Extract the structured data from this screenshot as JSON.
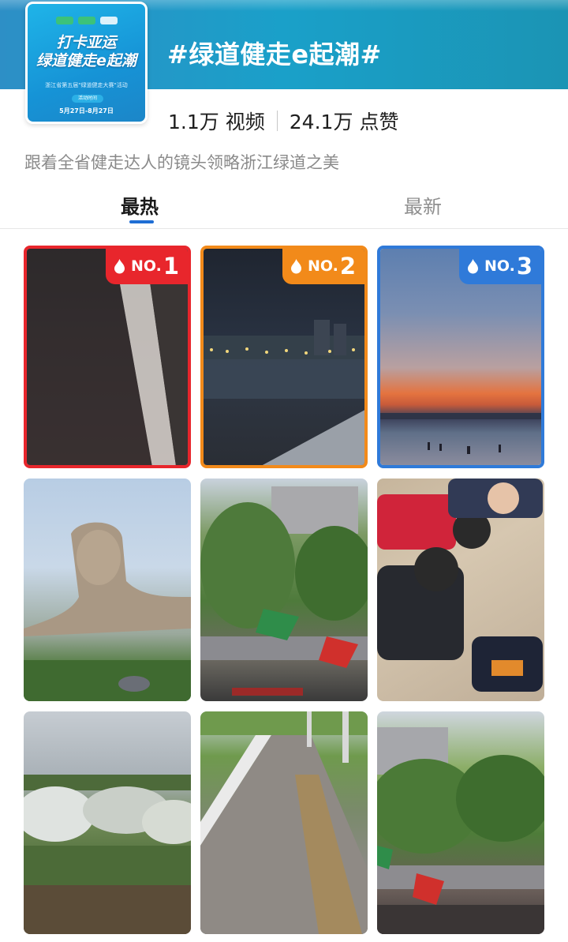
{
  "topic": {
    "title": "#绿道健走e起潮#",
    "cover": {
      "title_line1": "打卡亚运",
      "title_line2": "绿道健走e起潮",
      "subtitle": "浙江省第五届\"绿道健走大赛\"活动",
      "pill": "活动时间",
      "dates": "5月27日-8月27日"
    },
    "stats": {
      "videos_num": "1.1万",
      "videos_label": "视频",
      "likes_num": "24.1万",
      "likes_label": "点赞"
    },
    "description": "跟着全省健走达人的镜头领略浙江绿道之美"
  },
  "tabs": [
    {
      "label": "最热",
      "active": true
    },
    {
      "label": "最新",
      "active": false
    }
  ],
  "badges": {
    "no_label": "NO.",
    "rank1": "1",
    "rank2": "2",
    "rank3": "3",
    "colors": {
      "rank1": "#e8262c",
      "rank2": "#f28a1a",
      "rank3": "#2f7ad9"
    }
  },
  "videos": [
    {
      "thumb": "dark-road-night"
    },
    {
      "thumb": "river-city-night"
    },
    {
      "thumb": "lake-sunset"
    },
    {
      "thumb": "stone-statue"
    },
    {
      "thumb": "dragon-boat-flags"
    },
    {
      "thumb": "kids-game"
    },
    {
      "thumb": "flower-garden"
    },
    {
      "thumb": "greenway-path"
    },
    {
      "thumb": "riverside-crowd"
    }
  ],
  "accent": "#1f6ed4"
}
